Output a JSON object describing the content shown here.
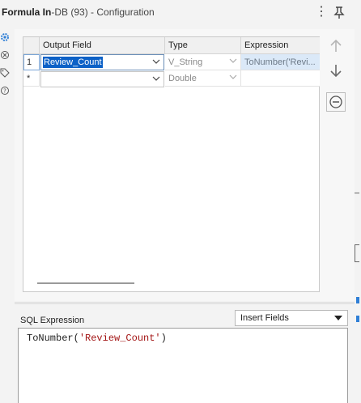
{
  "window": {
    "title_bold": "Formula In",
    "title_rest": "-DB (93) - Configuration"
  },
  "grid": {
    "headers": [
      "Output Field",
      "Type",
      "Expression"
    ],
    "rows": [
      {
        "num": "1",
        "field": "Review_Count",
        "type": "V_String",
        "expression": "ToNumber('Revi..."
      },
      {
        "num": "*",
        "field": "",
        "type": "Double",
        "expression": ""
      }
    ]
  },
  "sql": {
    "label": "SQL Expression",
    "insert_fields": "Insert Fields",
    "func": "ToNumber(",
    "arg": "'Review_Count'",
    "close": ")"
  },
  "icons": {
    "menu": "more-vertical-icon",
    "pin": "pin-icon",
    "side": [
      "gear-icon",
      "settings-circle-icon",
      "tag-icon",
      "help-icon"
    ],
    "buttons": [
      "arrow-up-icon",
      "arrow-down-icon",
      "remove-circle-icon"
    ]
  },
  "colors": {
    "selection": "#0c61c7",
    "string_literal": "#a31515",
    "accent": "#2f7fd6"
  }
}
